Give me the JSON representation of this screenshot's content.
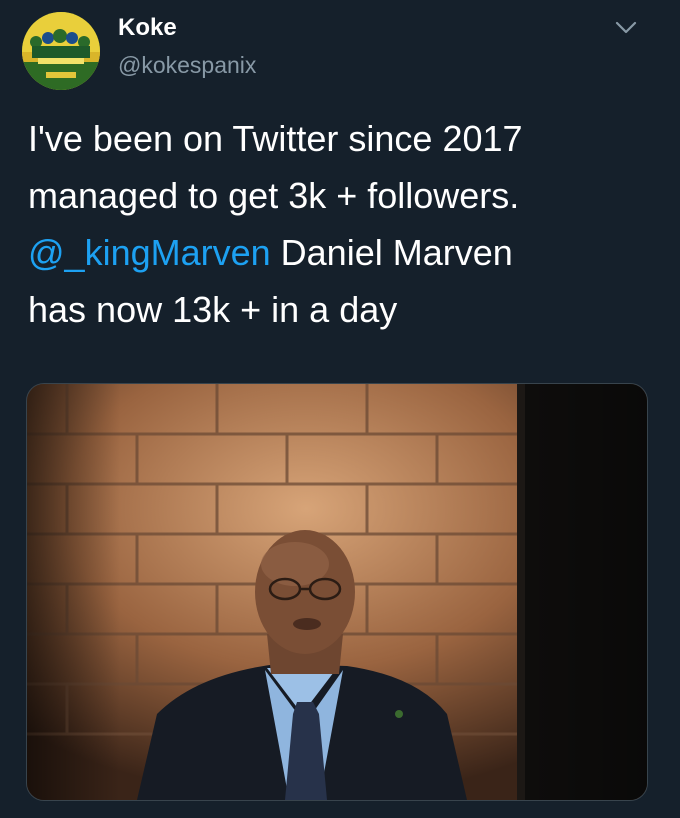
{
  "user": {
    "display_name": "Koke",
    "handle": "@kokespanix"
  },
  "tweet": {
    "line1": "I've been on Twitter since 2017",
    "line2": "managed to get 3k + followers.",
    "mention": "@_kingMarven",
    "line3_rest": " Daniel Marven",
    "line4": "has now 13k + in a day"
  },
  "icons": {
    "menu": "chevron-down-icon",
    "avatar": "team-photo-avatar"
  },
  "colors": {
    "background": "#15202b",
    "text": "#ffffff",
    "secondary": "#8899a6",
    "link": "#1da1f2",
    "border": "#38444d"
  }
}
